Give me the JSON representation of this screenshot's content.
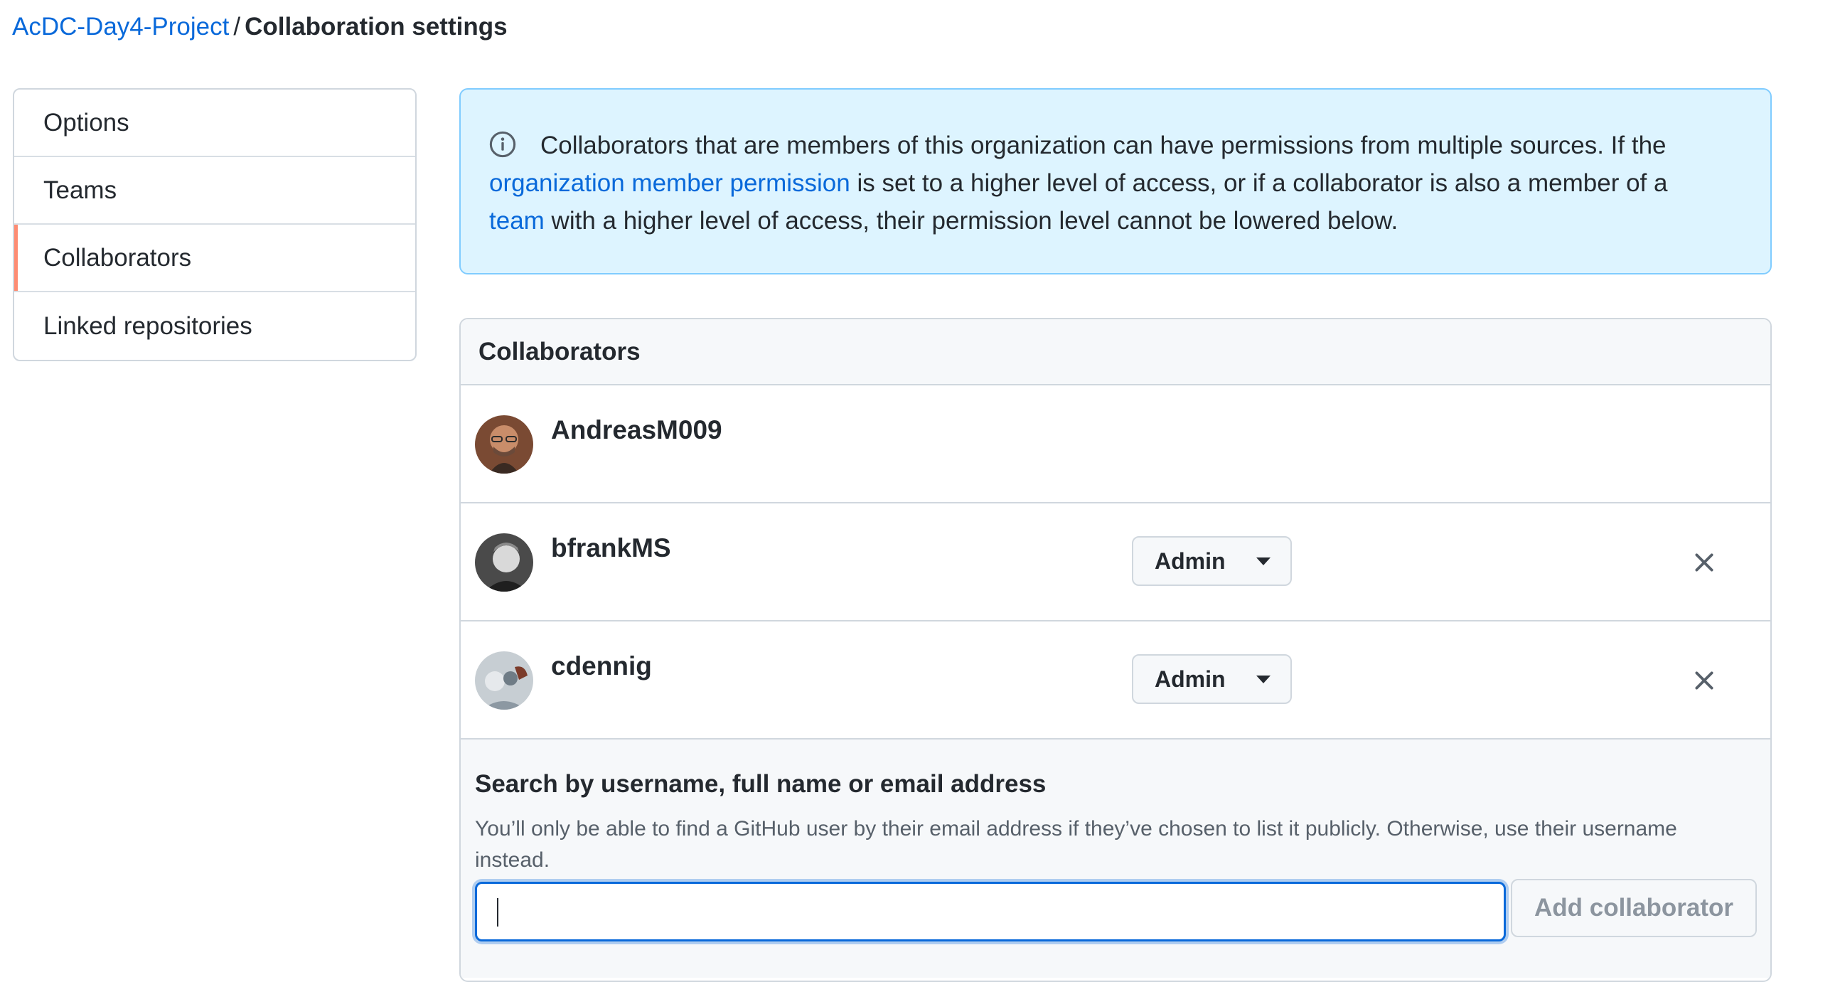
{
  "breadcrumb": {
    "repo": "AcDC-Day4-Project",
    "separator": "/",
    "title": "Collaboration settings"
  },
  "sidebar": {
    "items": [
      {
        "label": "Options"
      },
      {
        "label": "Teams"
      },
      {
        "label": "Collaborators",
        "selected": true
      },
      {
        "label": "Linked repositories"
      }
    ]
  },
  "flash": {
    "icon": "info-icon",
    "text_1": "Collaborators that are members of this organization can have permissions from multiple sources. If the",
    "link_1": "organization member permission",
    "text_2": "is set to a higher level of access, or if a collaborator is also a member of a",
    "link_2": "team",
    "text_3": "with a higher level of access, their permission level cannot be lowered below."
  },
  "collaborators": {
    "header": "Collaborators",
    "rows": [
      {
        "username": "AndreasM009"
      },
      {
        "username": "bfrankMS",
        "role": "Admin"
      },
      {
        "username": "cdennig",
        "role": "Admin"
      }
    ],
    "add": {
      "label": "Search by username, full name or email address",
      "note": "You’ll only be able to find a GitHub user by their email address if they’ve chosen to list it publicly. Otherwise, use their username instead.",
      "input_value": "",
      "button": "Add collaborator"
    }
  },
  "colors": {
    "link": "#0969da",
    "selected_indicator": "#fd8c73",
    "flash_bg": "#ddf4ff",
    "flash_border": "#80ccff"
  }
}
